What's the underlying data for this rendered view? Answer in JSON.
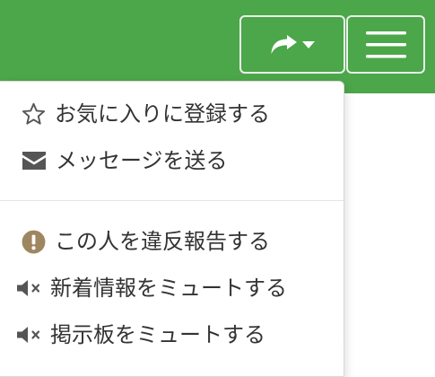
{
  "theme": {
    "header_green": "#4ca64a",
    "text": "#333333",
    "icon_gray": "#555555",
    "alert_brown": "#9e8660"
  },
  "header": {
    "share_button": {
      "icon": "share-icon",
      "caret": "caret-down-icon"
    },
    "menu_button": {
      "icon": "hamburger-menu-icon"
    }
  },
  "dropdown": {
    "items": [
      {
        "icon": "star-outline-icon",
        "label": "お気に入りに登録する"
      },
      {
        "icon": "envelope-icon",
        "label": "メッセージを送る"
      },
      {
        "icon": "exclamation-circle-icon",
        "label": "この人を違反報告する"
      },
      {
        "icon": "volume-mute-icon",
        "label": "新着情報をミュートする"
      },
      {
        "icon": "volume-mute-icon",
        "label": "掲示板をミュートする"
      }
    ]
  }
}
